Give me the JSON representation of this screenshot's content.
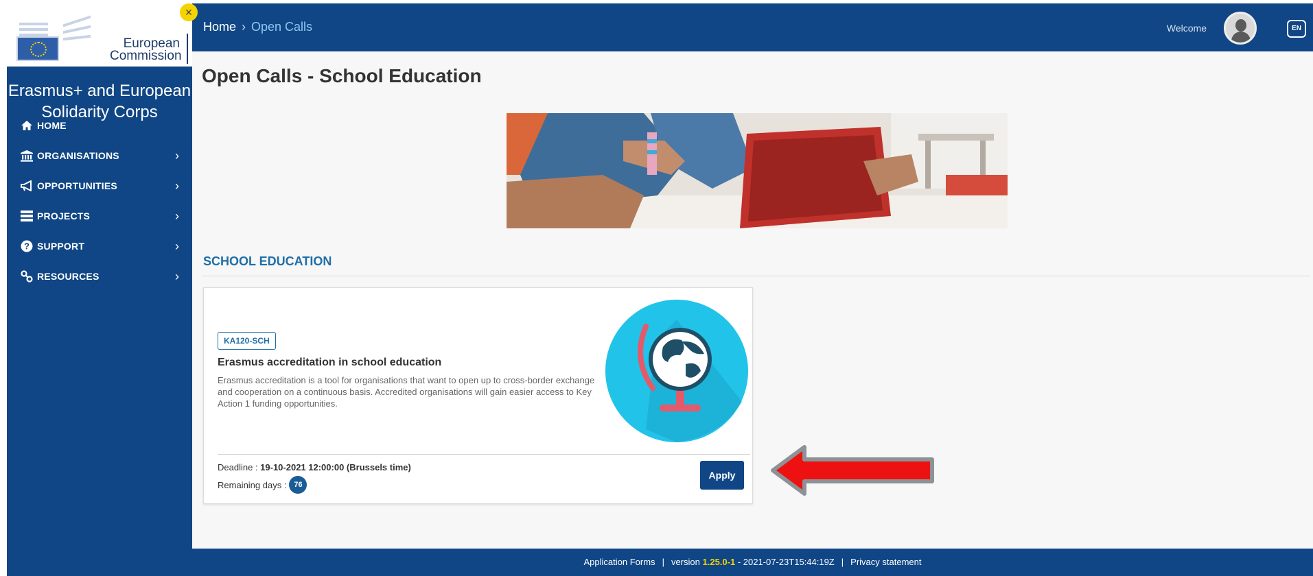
{
  "brand": {
    "logo_text_line1": "European",
    "logo_text_line2": "Commission",
    "close_glyph": "×"
  },
  "sidebar": {
    "title": "Erasmus+ and European Solidarity Corps",
    "items": [
      {
        "label": "HOME",
        "icon": "home-icon",
        "has_submenu": false
      },
      {
        "label": "ORGANISATIONS",
        "icon": "institution-icon",
        "has_submenu": true
      },
      {
        "label": "OPPORTUNITIES",
        "icon": "megaphone-icon",
        "has_submenu": true
      },
      {
        "label": "PROJECTS",
        "icon": "projects-icon",
        "has_submenu": true
      },
      {
        "label": "SUPPORT",
        "icon": "question-circle-icon",
        "has_submenu": true
      },
      {
        "label": "RESOURCES",
        "icon": "link-icon",
        "has_submenu": true
      }
    ]
  },
  "header": {
    "breadcrumb": {
      "home": "Home",
      "separator": "›",
      "current": "Open Calls"
    },
    "welcome": "Welcome",
    "language": "EN"
  },
  "main": {
    "page_title": "Open Calls - School Education",
    "section_heading": "SCHOOL EDUCATION",
    "card": {
      "badge": "KA120-SCH",
      "title": "Erasmus accreditation in school education",
      "description": "Erasmus accreditation is a tool for organisations that want to open up to cross-border exchange and cooperation on a continuous basis. Accredited organisations will gain easier access to Key Action 1 funding opportunities.",
      "deadline_label": "Deadline : ",
      "deadline_value": "19-10-2021 12:00:00 (Brussels time)",
      "remaining_label": "Remaining days :",
      "remaining_count": "76",
      "apply_label": "Apply"
    }
  },
  "footer": {
    "app": "Application Forms",
    "version_label": "version",
    "version_number": "1.25.0-1",
    "build": "- 2021-07-23T15:44:19Z",
    "privacy": "Privacy statement"
  },
  "colors": {
    "primary": "#104685",
    "accent": "#1f6ea5",
    "version_highlight": "#f5d300",
    "arrow": "#ee1111"
  }
}
